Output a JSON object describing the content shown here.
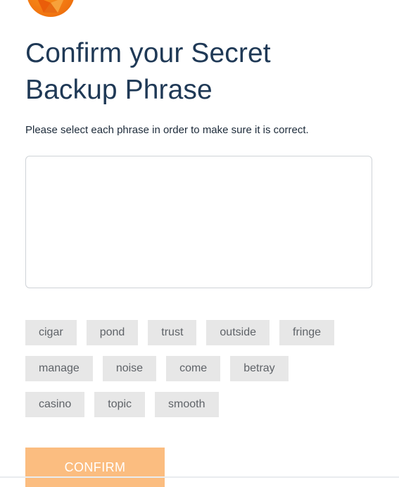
{
  "header": {
    "logo_icon": "fox-logo-icon",
    "title": "Confirm your Secret Backup Phrase",
    "subtitle": "Please select each phrase in order to make sure it is correct."
  },
  "phrase_box": {
    "selected_words": []
  },
  "word_bank": {
    "rows": [
      [
        "cigar",
        "pond",
        "trust",
        "outside",
        "fringe"
      ],
      [
        "manage",
        "noise",
        "come",
        "betray"
      ],
      [
        "casino",
        "topic",
        "smooth"
      ]
    ]
  },
  "actions": {
    "confirm_label": "CONFIRM",
    "confirm_enabled": false
  },
  "colors": {
    "title": "#1f3956",
    "word_chip_bg": "#e7e7e7",
    "confirm_disabled_bg": "#fbbd80",
    "brand_orange": "#f37a12"
  }
}
